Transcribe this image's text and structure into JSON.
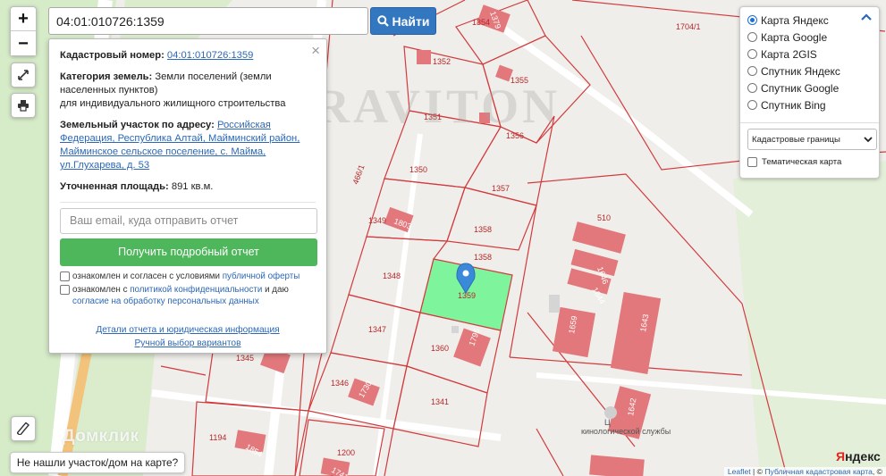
{
  "search": {
    "value": "04:01:010726:1359",
    "button_label": "Найти"
  },
  "controls": {
    "zoom_in": "+",
    "zoom_out": "−",
    "fullscreen_icon": "expand-icon",
    "print_icon": "printer-icon",
    "ruler_icon": "ruler-icon"
  },
  "popup": {
    "close": "×",
    "cadastral_label": "Кадастровый номер:",
    "cadastral_value": "04:01:010726:1359",
    "category_label": "Категория земель:",
    "category_value": "Земли поселений (земли населенных пунктов)",
    "category_use": "для индивидуального жилищного строительства",
    "address_label": "Земельный участок по адресу:",
    "address_value": "Российская Федерация, Республика Алтай, Майминский район, Майминское сельское поселение, с. Майма, ул.Глухарева, д. 53",
    "area_label": "Уточненная площадь:",
    "area_value": "891 кв.м.",
    "email_placeholder": "Ваш email, куда отправить отчет",
    "report_button": "Получить подробный отчет",
    "consent1_text": "ознакомлен и согласен с условиями",
    "consent1_link": "публичной оферты",
    "consent2_text_a": "ознакомлен с",
    "consent2_link_a": "политикой конфиденциальности",
    "consent2_text_b": "и даю",
    "consent2_link_b": "согласие на обработку персональных данных",
    "details_link": "Детали отчета и юридическая информация",
    "manual_link": "Ручной выбор вариантов"
  },
  "layers": {
    "options": [
      {
        "label": "Карта Яндекс",
        "selected": true
      },
      {
        "label": "Карта Google",
        "selected": false
      },
      {
        "label": "Карта 2GIS",
        "selected": false
      },
      {
        "label": "Спутник Яндекс",
        "selected": false
      },
      {
        "label": "Спутник Google",
        "selected": false
      },
      {
        "label": "Спутник Bing",
        "selected": false
      }
    ],
    "collapse_icon": "chevron-up-icon",
    "overlay_select": "Кадастровые границы",
    "thematic_label": "Тематическая карта",
    "thematic_checked": false
  },
  "map": {
    "watermark": "GRAVITON",
    "domclick": "Домклик",
    "plots": [
      "1352",
      "1354",
      "1355",
      "1351",
      "1356",
      "1350",
      "1357",
      "1349",
      "1358",
      "1358",
      "1348",
      "1359",
      "1347",
      "1360",
      "1345",
      "1346",
      "1341",
      "1194",
      "1200",
      "510",
      "1704/1",
      "466/1"
    ],
    "buildings": [
      "1379",
      "1803",
      "1646",
      "1644",
      "1659",
      "1643",
      "1795",
      "1730",
      "1854",
      "1642",
      "1741"
    ],
    "poi": "кинологической службы",
    "highlight_color": "#7ef59c",
    "boundary_color": "#d23b3e",
    "building_color": "#e2787b",
    "marker_color": "#3b8ad9"
  },
  "bottom": {
    "not_found": "Не нашли участок/дом на карте?",
    "yandex_logo_a": "Я",
    "yandex_logo_b": "ндекс",
    "attr_leaflet": "Leaflet",
    "attr_sep": " | © ",
    "attr_pkk": "Публичная кадастровая карта",
    "attr_tail": ", ©"
  }
}
